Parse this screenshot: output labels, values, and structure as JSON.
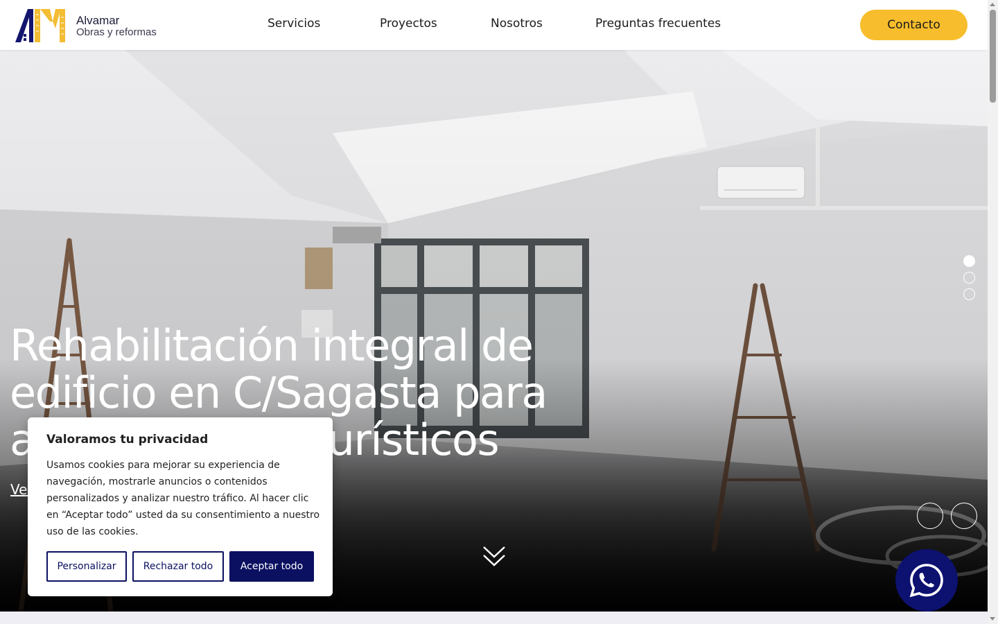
{
  "header": {
    "logo": {
      "initials": "AM",
      "name": "Alvamar",
      "subtitle": "Obras y reformas"
    },
    "nav": [
      {
        "label": "Servicios"
      },
      {
        "label": "Proyectos"
      },
      {
        "label": "Nosotros"
      },
      {
        "label": "Preguntas frecuentes"
      }
    ],
    "contact_label": "Contacto"
  },
  "hero": {
    "title": "Rehabilitación integral de edificio en C/Sagasta para apartamentos turísticos",
    "link_label": "Ver proyecto",
    "slides_total": 3,
    "active_slide": 1
  },
  "cookie": {
    "title": "Valoramos tu privacidad",
    "text": "Usamos cookies para mejorar su experiencia de navegación, mostrarle anuncios o contenidos personalizados y analizar nuestro tráfico. Al hacer clic en “Aceptar todo” usted da su consentimiento a nuestro uso de las cookies.",
    "buttons": {
      "customize": "Personalizar",
      "reject": "Rechazar todo",
      "accept": "Aceptar todo"
    }
  },
  "icons": {
    "scroll_down": "double-chevron-down-icon",
    "whatsapp": "whatsapp-icon",
    "prev": "chevron-left-icon",
    "next": "chevron-right-icon"
  },
  "colors": {
    "accent": "#f7bd2c",
    "brand_navy": "#0b1060",
    "whatsapp_bg": "#0d1170"
  }
}
